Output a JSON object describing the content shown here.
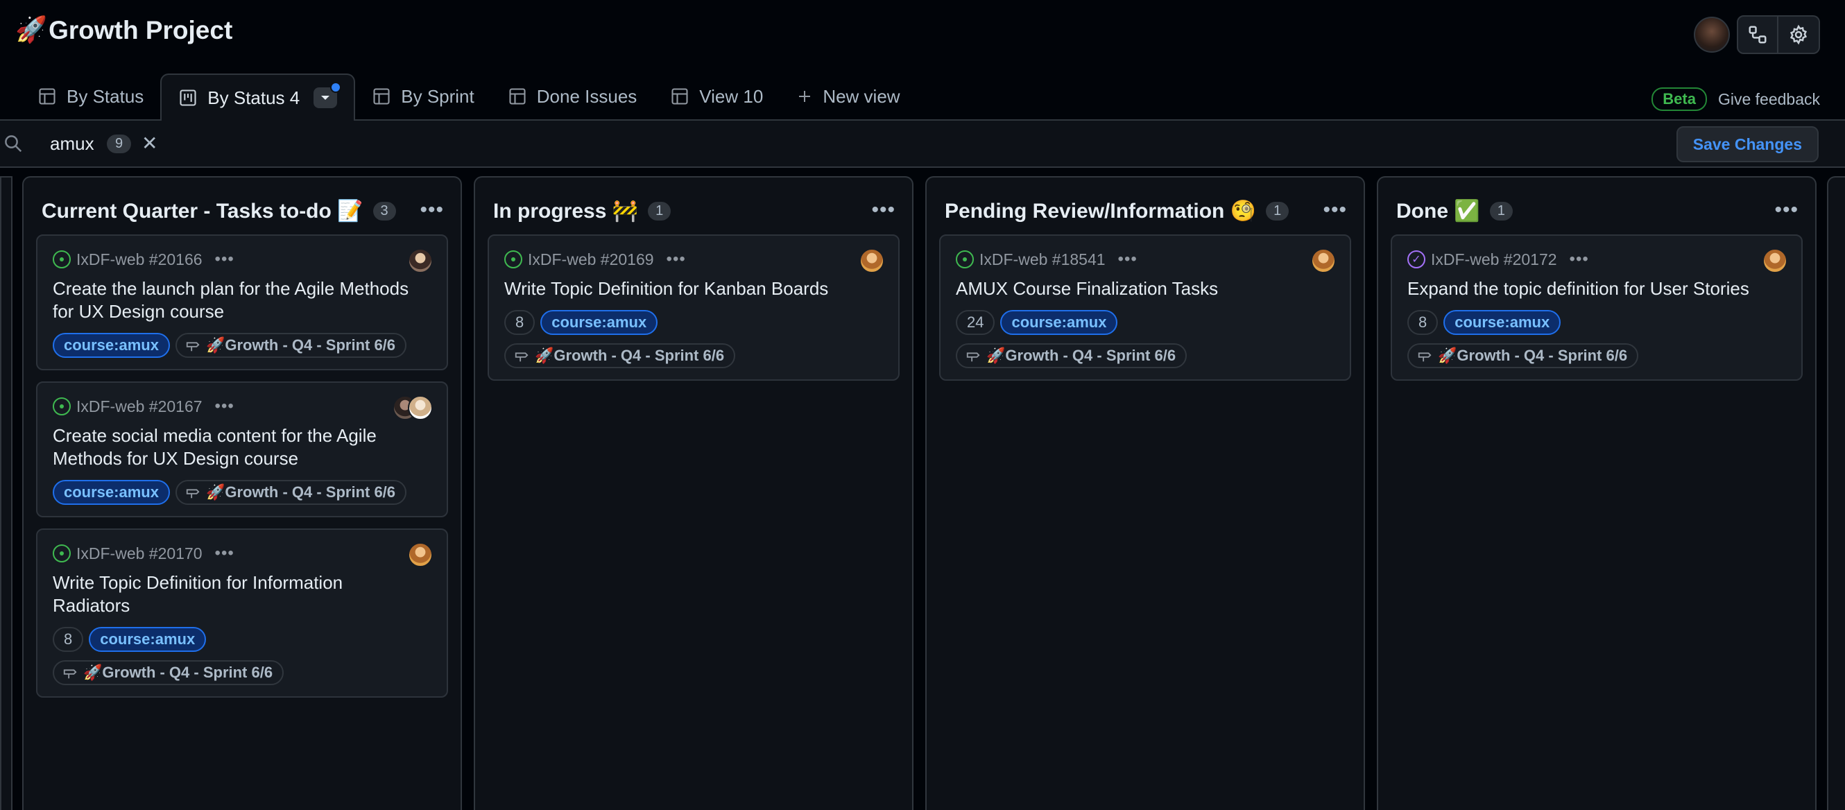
{
  "header": {
    "project_icon": "🚀",
    "project_title": "Growth Project"
  },
  "tabs": [
    {
      "label": "By Status",
      "icon": "table-icon"
    },
    {
      "label": "By Status 4",
      "icon": "board-icon",
      "active": true
    },
    {
      "label": "By Sprint",
      "icon": "table-icon"
    },
    {
      "label": "Done Issues",
      "icon": "table-icon"
    },
    {
      "label": "View 10",
      "icon": "table-icon"
    },
    {
      "label": "New view",
      "icon": "plus-icon"
    }
  ],
  "feedback": {
    "beta": "Beta",
    "link": "Give feedback"
  },
  "filter": {
    "query": "amux",
    "count": "9",
    "clear": "✕"
  },
  "save_label": "Save Changes",
  "columns": [
    {
      "title": "Current Quarter - Tasks to-do 📝",
      "count": "3",
      "cards": [
        {
          "id": "IxDF-web #20166",
          "title": "Create the launch plan for the Agile Methods for UX Design course",
          "estimate": "",
          "label": "course:amux",
          "sprint": "🚀Growth - Q4 - Sprint 6/6",
          "status": "open"
        },
        {
          "id": "IxDF-web #20167",
          "title": "Create social media content for the Agile Methods for UX Design course",
          "estimate": "",
          "label": "course:amux",
          "sprint": "🚀Growth - Q4 - Sprint 6/6",
          "status": "open"
        },
        {
          "id": "IxDF-web #20170",
          "title": "Write Topic Definition for Information Radiators",
          "estimate": "8",
          "label": "course:amux",
          "sprint": "🚀Growth - Q4 - Sprint 6/6",
          "status": "open"
        }
      ]
    },
    {
      "title": "In progress 🚧",
      "count": "1",
      "cards": [
        {
          "id": "IxDF-web #20169",
          "title": "Write Topic Definition for Kanban Boards",
          "estimate": "8",
          "label": "course:amux",
          "sprint": "🚀Growth - Q4 - Sprint 6/6",
          "status": "open"
        }
      ]
    },
    {
      "title": "Pending Review/Information 🧐",
      "count": "1",
      "cards": [
        {
          "id": "IxDF-web #18541",
          "title": "AMUX Course Finalization Tasks",
          "estimate": "24",
          "label": "course:amux",
          "sprint": "🚀Growth - Q4 - Sprint 6/6",
          "status": "open"
        }
      ]
    },
    {
      "title": "Done ✅",
      "count": "1",
      "cards": [
        {
          "id": "IxDF-web #20172",
          "title": "Expand the topic definition for User Stories",
          "estimate": "8",
          "label": "course:amux",
          "sprint": "🚀Growth - Q4 - Sprint 6/6",
          "status": "done"
        }
      ]
    }
  ],
  "colors": {
    "background": "#010409",
    "panel": "#0d1117",
    "card": "#161b22",
    "accent": "#2f81f7",
    "open": "#3fb950",
    "done": "#a371f7"
  }
}
